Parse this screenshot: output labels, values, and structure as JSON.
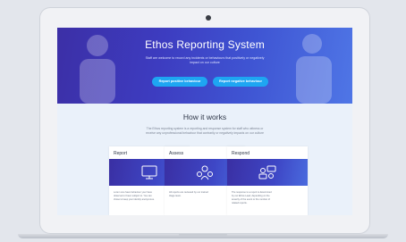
{
  "hero": {
    "title": "Ethos Reporting System",
    "subtitle": "Staff are welcome to record any incidents or behaviours that positively or negatively impact on our culture",
    "buttons": {
      "positive": "Report positive behaviour",
      "negative": "Report negative behaviour"
    }
  },
  "how_it_works": {
    "title": "How it works",
    "subtitle": "The Ethos reporting system is a reporting and response system for staff who witness or receive any unprofessional behaviour that contrarily or negatively impacts on our culture",
    "cards": [
      {
        "title": "Report",
        "icon": "monitor-icon",
        "text": "Lorem one have behaviour your have observed or been subject to. You can chose to keep your identity anonymous."
      },
      {
        "title": "Assess",
        "icon": "team-icon",
        "text": "All reports are reviewed by our trained triage team."
      },
      {
        "title": "Respond",
        "icon": "conversation-icon",
        "text": "The response to a report is determined by our Ethos Lead, depending on the severity of the event or the number of related reports."
      }
    ]
  },
  "colors": {
    "hero_start": "#3c2fa6",
    "hero_end": "#4f76e6",
    "button": "#1ea6f2",
    "page_bg": "#eaf1fa"
  }
}
